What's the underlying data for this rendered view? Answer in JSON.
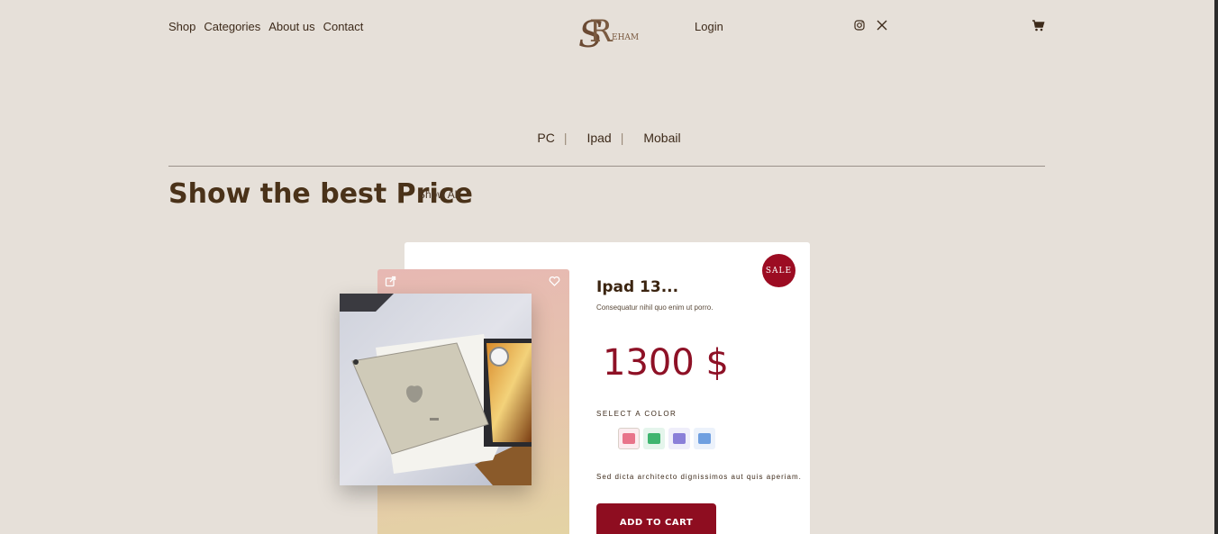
{
  "header": {
    "nav": [
      "Shop",
      "Categories",
      "About us",
      "Contact"
    ],
    "logo_letters": "RS",
    "logo_text": "EHAM",
    "login": "Login",
    "social_icons": [
      "instagram-icon",
      "x-icon"
    ],
    "cart_icon": "cart-icon"
  },
  "categories": [
    {
      "label": "PC"
    },
    {
      "label": "Ipad"
    },
    {
      "label": "Mobail"
    }
  ],
  "separator": "|",
  "section": {
    "title": "Show the best Price",
    "show_all": "Show All"
  },
  "product": {
    "badge": "SALE",
    "title": "Ipad 13...",
    "description": "Consequatur nihil quo enim ut porro.",
    "price": "1300 $",
    "color_label": "SELECT A COLOR",
    "swatches": [
      {
        "color": "#e8748a",
        "selected": true
      },
      {
        "color": "#3fb56f",
        "selected": false
      },
      {
        "color": "#8a7fd8",
        "selected": false
      },
      {
        "color": "#6f9fe0",
        "selected": false
      }
    ],
    "tagline": "Sed dicta architecto dignissimos aut quis aperiam.",
    "add_to_cart": "ADD TO CART",
    "colors": {
      "accent": "#8e0d20",
      "badge": "#9c0c22",
      "background": "#e6e0d9"
    }
  }
}
